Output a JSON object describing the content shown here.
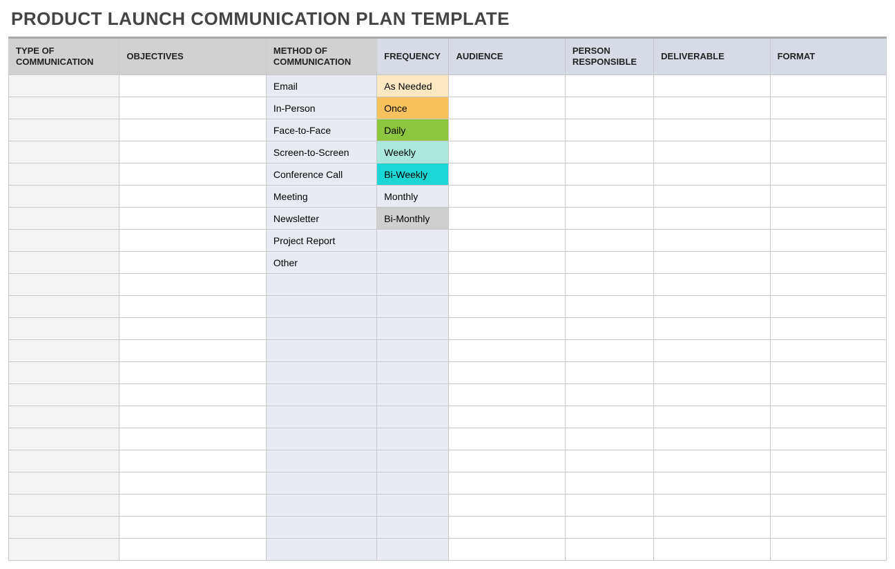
{
  "title": "PRODUCT LAUNCH COMMUNICATION PLAN TEMPLATE",
  "headers": {
    "type": "TYPE OF COMMUNICATION",
    "objectives": "OBJECTIVES",
    "method": "METHOD OF COMMUNICATION",
    "frequency": "FREQUENCY",
    "audience": "AUDIENCE",
    "person": "PERSON RESPONSIBLE",
    "deliverable": "DELIVERABLE",
    "format": "FORMAT"
  },
  "rows": [
    {
      "type": "",
      "objectives": "",
      "method": "Email",
      "frequency": "As Needed",
      "freq_class": "freq-asneeded",
      "audience": "",
      "person": "",
      "deliverable": "",
      "format": ""
    },
    {
      "type": "",
      "objectives": "",
      "method": "In-Person",
      "frequency": "Once",
      "freq_class": "freq-once",
      "audience": "",
      "person": "",
      "deliverable": "",
      "format": ""
    },
    {
      "type": "",
      "objectives": "",
      "method": "Face-to-Face",
      "frequency": "Daily",
      "freq_class": "freq-daily",
      "audience": "",
      "person": "",
      "deliverable": "",
      "format": ""
    },
    {
      "type": "",
      "objectives": "",
      "method": "Screen-to-Screen",
      "frequency": "Weekly",
      "freq_class": "freq-weekly",
      "audience": "",
      "person": "",
      "deliverable": "",
      "format": ""
    },
    {
      "type": "",
      "objectives": "",
      "method": "Conference Call",
      "frequency": "Bi-Weekly",
      "freq_class": "freq-biweekly",
      "audience": "",
      "person": "",
      "deliverable": "",
      "format": ""
    },
    {
      "type": "",
      "objectives": "",
      "method": "Meeting",
      "frequency": "Monthly",
      "freq_class": "freq-monthly",
      "audience": "",
      "person": "",
      "deliverable": "",
      "format": ""
    },
    {
      "type": "",
      "objectives": "",
      "method": "Newsletter",
      "frequency": "Bi-Monthly",
      "freq_class": "freq-bimonthly",
      "audience": "",
      "person": "",
      "deliverable": "",
      "format": ""
    },
    {
      "type": "",
      "objectives": "",
      "method": "Project Report",
      "frequency": "",
      "freq_class": "",
      "audience": "",
      "person": "",
      "deliverable": "",
      "format": ""
    },
    {
      "type": "",
      "objectives": "",
      "method": "Other",
      "frequency": "",
      "freq_class": "",
      "audience": "",
      "person": "",
      "deliverable": "",
      "format": ""
    },
    {
      "type": "",
      "objectives": "",
      "method": "",
      "frequency": "",
      "freq_class": "",
      "audience": "",
      "person": "",
      "deliverable": "",
      "format": ""
    },
    {
      "type": "",
      "objectives": "",
      "method": "",
      "frequency": "",
      "freq_class": "",
      "audience": "",
      "person": "",
      "deliverable": "",
      "format": ""
    },
    {
      "type": "",
      "objectives": "",
      "method": "",
      "frequency": "",
      "freq_class": "",
      "audience": "",
      "person": "",
      "deliverable": "",
      "format": ""
    },
    {
      "type": "",
      "objectives": "",
      "method": "",
      "frequency": "",
      "freq_class": "",
      "audience": "",
      "person": "",
      "deliverable": "",
      "format": ""
    },
    {
      "type": "",
      "objectives": "",
      "method": "",
      "frequency": "",
      "freq_class": "",
      "audience": "",
      "person": "",
      "deliverable": "",
      "format": ""
    },
    {
      "type": "",
      "objectives": "",
      "method": "",
      "frequency": "",
      "freq_class": "",
      "audience": "",
      "person": "",
      "deliverable": "",
      "format": ""
    },
    {
      "type": "",
      "objectives": "",
      "method": "",
      "frequency": "",
      "freq_class": "",
      "audience": "",
      "person": "",
      "deliverable": "",
      "format": ""
    },
    {
      "type": "",
      "objectives": "",
      "method": "",
      "frequency": "",
      "freq_class": "",
      "audience": "",
      "person": "",
      "deliverable": "",
      "format": ""
    },
    {
      "type": "",
      "objectives": "",
      "method": "",
      "frequency": "",
      "freq_class": "",
      "audience": "",
      "person": "",
      "deliverable": "",
      "format": ""
    },
    {
      "type": "",
      "objectives": "",
      "method": "",
      "frequency": "",
      "freq_class": "",
      "audience": "",
      "person": "",
      "deliverable": "",
      "format": ""
    },
    {
      "type": "",
      "objectives": "",
      "method": "",
      "frequency": "",
      "freq_class": "",
      "audience": "",
      "person": "",
      "deliverable": "",
      "format": ""
    },
    {
      "type": "",
      "objectives": "",
      "method": "",
      "frequency": "",
      "freq_class": "",
      "audience": "",
      "person": "",
      "deliverable": "",
      "format": ""
    },
    {
      "type": "",
      "objectives": "",
      "method": "",
      "frequency": "",
      "freq_class": "",
      "audience": "",
      "person": "",
      "deliverable": "",
      "format": ""
    }
  ]
}
